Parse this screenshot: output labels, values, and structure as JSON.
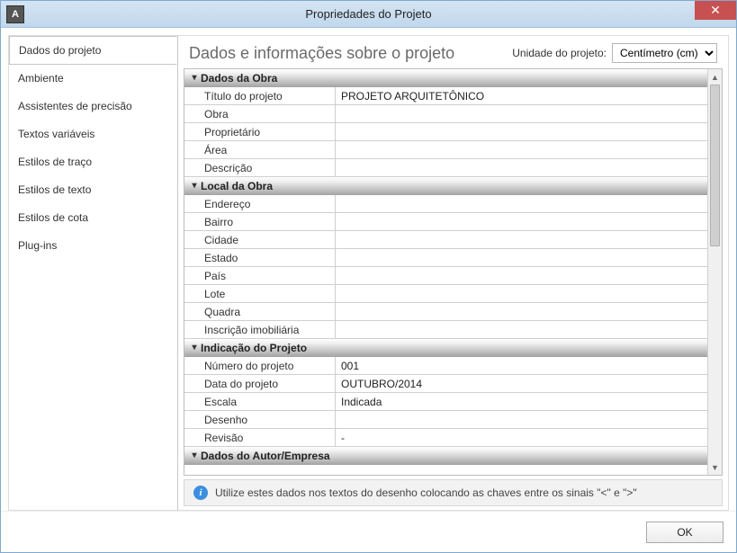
{
  "window": {
    "title": "Propriedades do Projeto",
    "app_icon_text": "A"
  },
  "sidebar": {
    "items": [
      {
        "label": "Dados do projeto",
        "active": true
      },
      {
        "label": "Ambiente",
        "active": false
      },
      {
        "label": "Assistentes de precisão",
        "active": false
      },
      {
        "label": "Textos variáveis",
        "active": false
      },
      {
        "label": "Estilos de traço",
        "active": false
      },
      {
        "label": "Estilos de texto",
        "active": false
      },
      {
        "label": "Estilos de cota",
        "active": false
      },
      {
        "label": "Plug-ins",
        "active": false
      }
    ]
  },
  "content": {
    "heading": "Dados e informações sobre o projeto",
    "unit_label": "Unidade do projeto:",
    "unit_value": "Centímetro (cm)"
  },
  "sections": [
    {
      "title": "Dados da Obra",
      "rows": [
        {
          "label": "Título do projeto",
          "value": "PROJETO ARQUITETÔNICO"
        },
        {
          "label": "Obra",
          "value": ""
        },
        {
          "label": "Proprietário",
          "value": ""
        },
        {
          "label": "Área",
          "value": ""
        },
        {
          "label": "Descrição",
          "value": ""
        }
      ]
    },
    {
      "title": "Local da Obra",
      "rows": [
        {
          "label": "Endereço",
          "value": ""
        },
        {
          "label": "Bairro",
          "value": ""
        },
        {
          "label": "Cidade",
          "value": ""
        },
        {
          "label": "Estado",
          "value": ""
        },
        {
          "label": "País",
          "value": ""
        },
        {
          "label": "Lote",
          "value": ""
        },
        {
          "label": "Quadra",
          "value": ""
        },
        {
          "label": "Inscrição imobiliária",
          "value": ""
        }
      ]
    },
    {
      "title": "Indicação do Projeto",
      "rows": [
        {
          "label": "Número do projeto",
          "value": "001"
        },
        {
          "label": "Data do projeto",
          "value": "OUTUBRO/2014"
        },
        {
          "label": "Escala",
          "value": "Indicada"
        },
        {
          "label": "Desenho",
          "value": ""
        },
        {
          "label": "Revisão",
          "value": "-"
        }
      ]
    },
    {
      "title": "Dados do Autor/Empresa",
      "rows": []
    }
  ],
  "info_bar": {
    "text": "Utilize estes dados nos textos do desenho colocando as chaves entre os sinais \"<\" e \">\""
  },
  "footer": {
    "ok_label": "OK"
  }
}
